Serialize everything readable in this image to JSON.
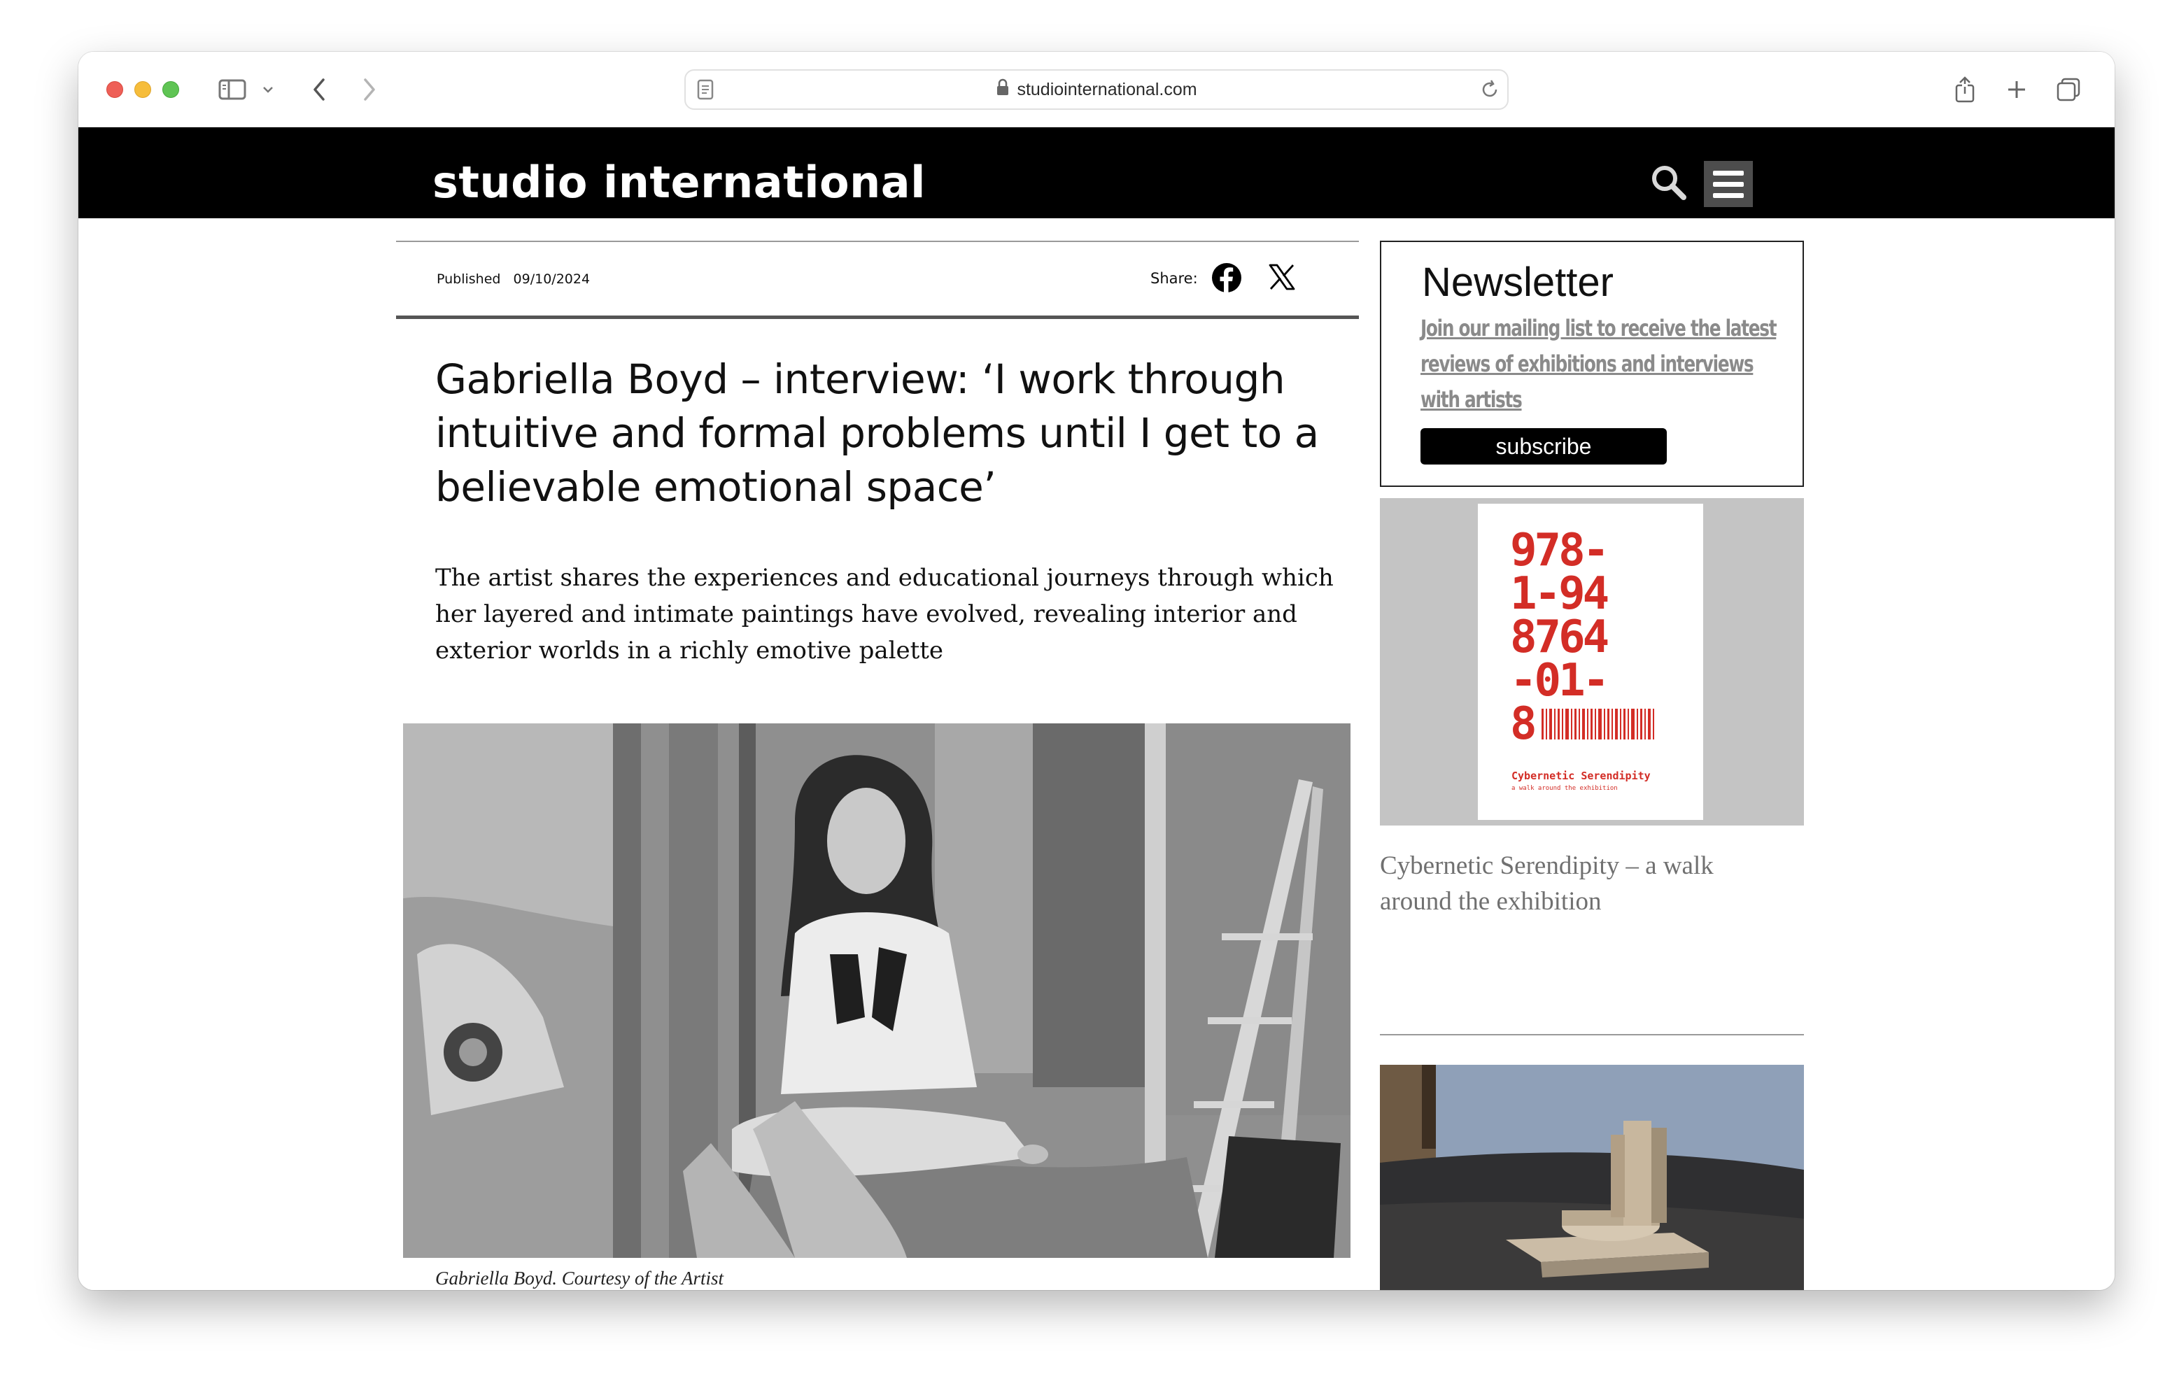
{
  "browser": {
    "url": "studiointernational.com"
  },
  "site": {
    "logo": "studio international"
  },
  "article": {
    "published_label": "Published",
    "published_date": "09/10/2024",
    "share_label": "Share:",
    "headline": "Gabriella Boyd – interview: ‘I work through intuitive and formal problems until I get to a believable emotional space’",
    "standfirst": "The artist shares the experiences and educational journeys through which her layered and intimate paintings have evolved, revealing interior and exterior worlds in a richly emotive palette",
    "image_caption": "Gabriella Boyd. Courtesy of the Artist"
  },
  "sidebar": {
    "newsletter": {
      "title": "Newsletter",
      "text": "Join our mailing list to receive the latest reviews of exhibitions and interviews with artists",
      "button": "subscribe"
    },
    "card1": {
      "book_code": [
        "978-",
        "1-94",
        "8764",
        "-01-",
        "8"
      ],
      "book_title": "Cybernetic Serendipity",
      "book_subtitle": "a walk around the exhibition",
      "title": "Cybernetic Serendipity – a walk around the exhibition"
    }
  },
  "colors": {
    "header_bg": "#000000",
    "accent_red": "#d32d26",
    "newsletter_text": "#8a8a8a"
  }
}
